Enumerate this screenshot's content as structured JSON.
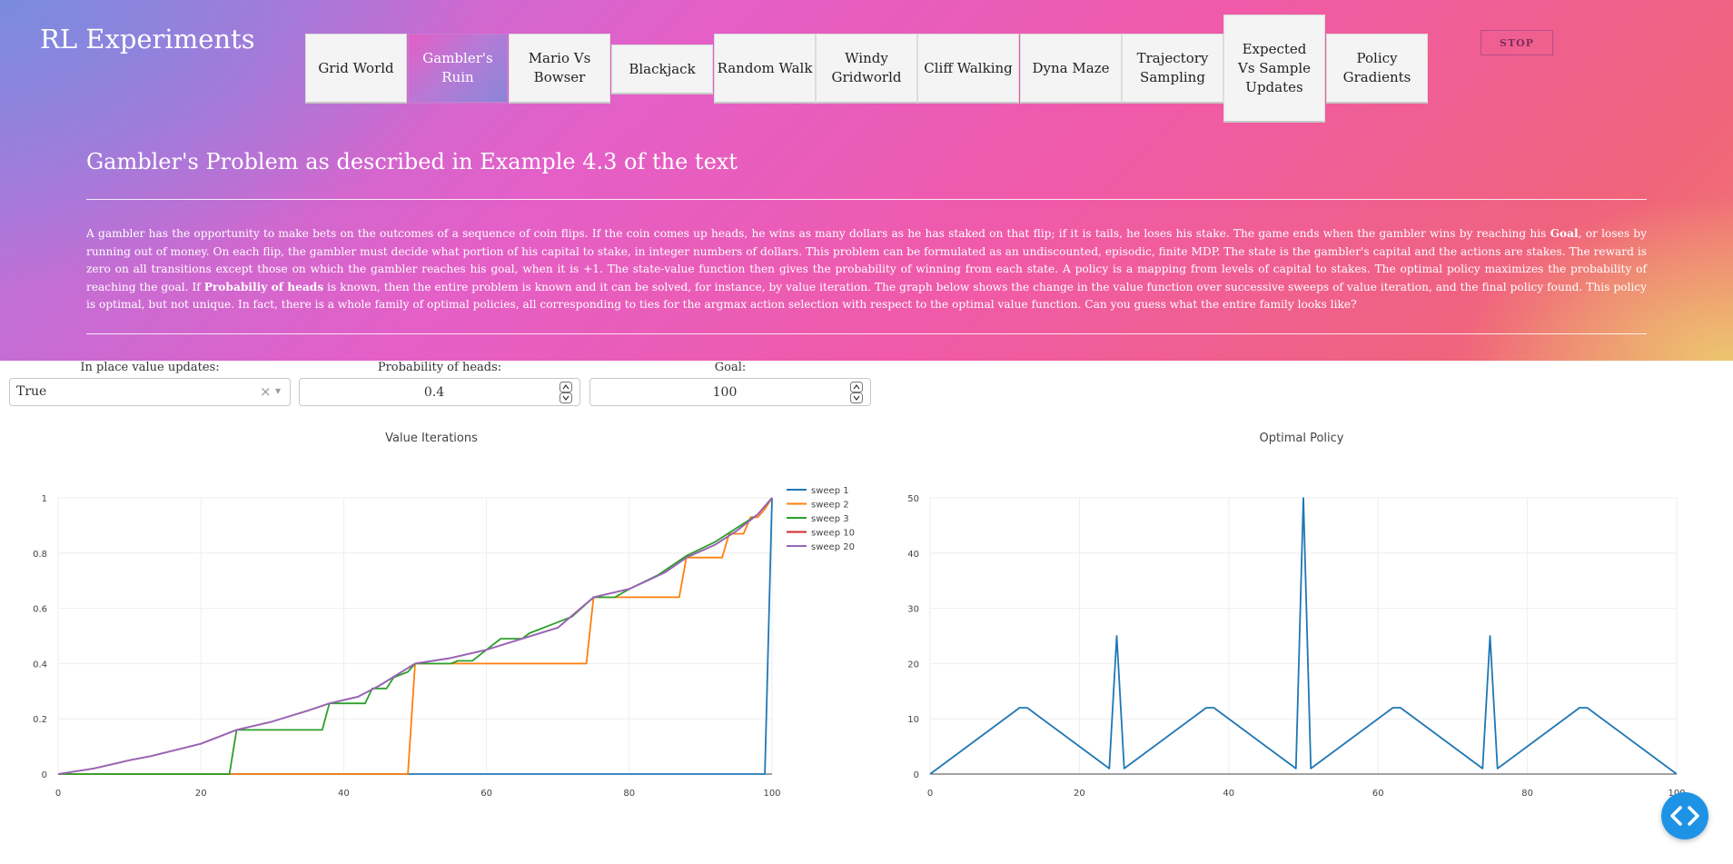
{
  "app": {
    "title": "RL Experiments"
  },
  "tabs": [
    {
      "label": "Grid World"
    },
    {
      "label": "Gambler's Ruin",
      "active": true
    },
    {
      "label": "Mario Vs Bowser"
    },
    {
      "label": "Blackjack"
    },
    {
      "label": "Random Walk"
    },
    {
      "label": "Windy Gridworld"
    },
    {
      "label": "Cliff Walking"
    },
    {
      "label": "Dyna Maze"
    },
    {
      "label": "Trajectory Sampling"
    },
    {
      "label": "Expected Vs Sample Updates"
    },
    {
      "label": "Policy Gradients"
    }
  ],
  "stop_label": "STOP",
  "page": {
    "heading": "Gambler's Problem as described in Example 4.3 of the text",
    "description": {
      "part1": "A gambler has the opportunity to make bets on the outcomes of a sequence of coin flips. If the coin comes up heads, he wins as many dollars as he has staked on that flip; if it is tails, he loses his stake. The game ends when the gambler wins by reaching his ",
      "bold1": "Goal",
      "part2": ", or loses by running out of money. On each flip, the gambler must decide what portion of his capital to stake, in integer numbers of dollars. This problem can be formulated as an undiscounted, episodic, finite MDP. The state is the gambler's capital and the actions are stakes. The reward is zero on all transitions except those on which the gambler reaches his goal, when it is +1. The state-value function then gives the probability of winning from each state. A policy is a mapping from levels of capital to stakes. The optimal policy maximizes the probability of reaching the goal. If ",
      "bold2": "Probabiliy of heads",
      "part3": " is known, then the entire problem is known and it can be solved, for instance, by value iteration. The graph below shows the change in the value function over successive sweeps of value iteration, and the final policy found. This policy is optimal, but not unique. In fact, there is a whole family of optimal policies, all corresponding to ties for the argmax action selection with respect to the optimal value function. Can you guess what the entire family looks like?"
    }
  },
  "controls": {
    "inplace": {
      "label": "In place value updates:",
      "value": "True",
      "clear": "×",
      "arrow": "▾"
    },
    "prob": {
      "label": "Probability of heads:",
      "value": "0.4"
    },
    "goal": {
      "label": "Goal:",
      "value": "100"
    }
  },
  "colors": {
    "sweep1": "#1f77b4",
    "sweep2": "#ff7f0e",
    "sweep3": "#2ca02c",
    "sweep10": "#d62728",
    "sweep20": "#9467bd",
    "fab": "#1e93e6"
  },
  "icons": {
    "fab": "code-icon",
    "clear": "clear-icon",
    "dropdown": "chevron-down-icon",
    "spin": "spinner-icon"
  },
  "chart_data": [
    {
      "type": "line",
      "title": "Value Iterations",
      "xlabel": "",
      "ylabel": "",
      "xlim": [
        0,
        100
      ],
      "ylim": [
        0,
        1
      ],
      "xticks": [
        0,
        20,
        40,
        60,
        80,
        100
      ],
      "yticks": [
        0,
        0.2,
        0.4,
        0.6,
        0.8,
        1
      ],
      "legend": "top-right",
      "grid": true,
      "series": [
        {
          "name": "sweep 1",
          "points": [
            [
              0,
              0
            ],
            [
              99,
              0
            ],
            [
              100,
              1
            ]
          ]
        },
        {
          "name": "sweep 2",
          "points": [
            [
              0,
              0
            ],
            [
              49,
              0
            ],
            [
              50,
              0.4
            ],
            [
              74,
              0.4
            ],
            [
              75,
              0.64
            ],
            [
              87,
              0.64
            ],
            [
              88,
              0.784
            ],
            [
              93,
              0.784
            ],
            [
              94,
              0.87
            ],
            [
              96,
              0.87
            ],
            [
              97,
              0.93
            ],
            [
              98,
              0.93
            ],
            [
              99,
              0.96
            ],
            [
              100,
              1
            ]
          ]
        },
        {
          "name": "sweep 3",
          "points": [
            [
              0,
              0
            ],
            [
              24,
              0
            ],
            [
              25,
              0.16
            ],
            [
              37,
              0.16
            ],
            [
              38,
              0.256
            ],
            [
              43,
              0.256
            ],
            [
              44,
              0.31
            ],
            [
              46,
              0.31
            ],
            [
              47,
              0.35
            ],
            [
              49,
              0.37
            ],
            [
              50,
              0.4
            ],
            [
              55,
              0.4
            ],
            [
              56,
              0.41
            ],
            [
              58,
              0.41
            ],
            [
              60,
              0.45
            ],
            [
              62,
              0.49
            ],
            [
              65,
              0.49
            ],
            [
              66,
              0.51
            ],
            [
              70,
              0.55
            ],
            [
              72,
              0.57
            ],
            [
              75,
              0.64
            ],
            [
              78,
              0.64
            ],
            [
              80,
              0.67
            ],
            [
              84,
              0.72
            ],
            [
              88,
              0.79
            ],
            [
              92,
              0.84
            ],
            [
              95,
              0.89
            ],
            [
              98,
              0.94
            ],
            [
              100,
              1
            ]
          ]
        },
        {
          "name": "sweep 10",
          "points": [
            [
              0,
              0
            ],
            [
              5,
              0.02
            ],
            [
              10,
              0.05
            ],
            [
              13,
              0.065
            ],
            [
              20,
              0.11
            ],
            [
              25,
              0.16
            ],
            [
              30,
              0.19
            ],
            [
              35,
              0.23
            ],
            [
              38,
              0.256
            ],
            [
              42,
              0.28
            ],
            [
              45,
              0.32
            ],
            [
              50,
              0.4
            ],
            [
              55,
              0.42
            ],
            [
              60,
              0.45
            ],
            [
              65,
              0.49
            ],
            [
              70,
              0.53
            ],
            [
              75,
              0.64
            ],
            [
              80,
              0.67
            ],
            [
              85,
              0.73
            ],
            [
              88,
              0.784
            ],
            [
              92,
              0.83
            ],
            [
              95,
              0.88
            ],
            [
              98,
              0.94
            ],
            [
              100,
              1
            ]
          ]
        },
        {
          "name": "sweep 20",
          "points": [
            [
              0,
              0
            ],
            [
              5,
              0.02
            ],
            [
              10,
              0.05
            ],
            [
              13,
              0.065
            ],
            [
              20,
              0.11
            ],
            [
              25,
              0.16
            ],
            [
              30,
              0.19
            ],
            [
              35,
              0.23
            ],
            [
              38,
              0.256
            ],
            [
              42,
              0.28
            ],
            [
              45,
              0.32
            ],
            [
              50,
              0.4
            ],
            [
              55,
              0.42
            ],
            [
              60,
              0.45
            ],
            [
              65,
              0.49
            ],
            [
              70,
              0.53
            ],
            [
              75,
              0.64
            ],
            [
              80,
              0.67
            ],
            [
              85,
              0.73
            ],
            [
              88,
              0.784
            ],
            [
              92,
              0.83
            ],
            [
              95,
              0.88
            ],
            [
              98,
              0.94
            ],
            [
              100,
              1
            ]
          ]
        }
      ]
    },
    {
      "type": "line",
      "title": "Optimal Policy",
      "xlabel": "",
      "ylabel": "",
      "xlim": [
        0,
        100
      ],
      "ylim": [
        0,
        50
      ],
      "xticks": [
        0,
        20,
        40,
        60,
        80,
        100
      ],
      "yticks": [
        0,
        10,
        20,
        30,
        40,
        50
      ],
      "grid": true,
      "series": [
        {
          "name": "",
          "points": [
            [
              0,
              0
            ],
            [
              12,
              12
            ],
            [
              13,
              12
            ],
            [
              24,
              1
            ],
            [
              25,
              25
            ],
            [
              26,
              1
            ],
            [
              37,
              12
            ],
            [
              38,
              12
            ],
            [
              49,
              1
            ],
            [
              50,
              50
            ],
            [
              51,
              1
            ],
            [
              62,
              12
            ],
            [
              63,
              12
            ],
            [
              74,
              1
            ],
            [
              75,
              25
            ],
            [
              76,
              1
            ],
            [
              87,
              12
            ],
            [
              88,
              12
            ],
            [
              100,
              0
            ]
          ]
        }
      ]
    }
  ]
}
